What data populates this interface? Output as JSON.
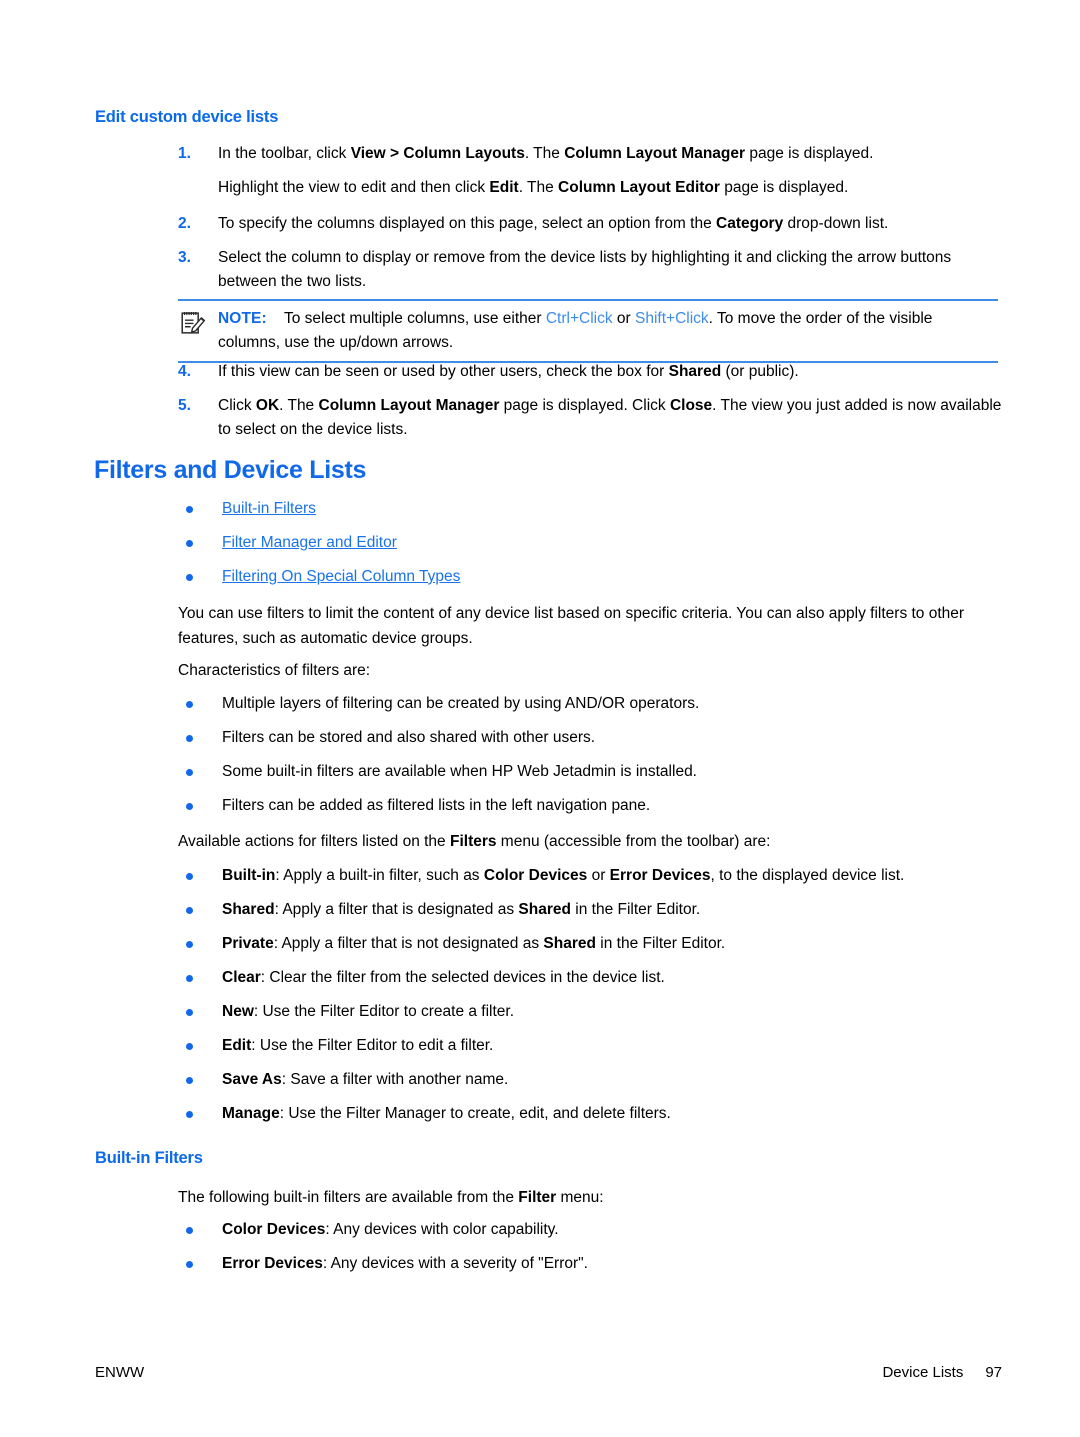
{
  "colors": {
    "heading_blue": "#1168e8",
    "link_blue": "#1a73e8",
    "note_rule": "#3d8ce8",
    "bullet": "#1168e8",
    "text": "#000000"
  },
  "section_edit_custom": {
    "heading": "Edit custom device lists",
    "steps": [
      {
        "num": "1.",
        "parts": [
          {
            "t": "In the toolbar, click ",
            "b": false
          },
          {
            "t": "View > Column Layouts",
            "b": true
          },
          {
            "t": ". The ",
            "b": false
          },
          {
            "t": "Column Layout Manager",
            "b": true
          },
          {
            "t": " page is displayed.",
            "b": false
          }
        ]
      }
    ],
    "step1_continuation": [
      {
        "t": "Highlight the view to edit and then click ",
        "b": false
      },
      {
        "t": "Edit",
        "b": true
      },
      {
        "t": ". The ",
        "b": false
      },
      {
        "t": "Column Layout Editor",
        "b": true
      },
      {
        "t": " page is displayed.",
        "b": false
      }
    ],
    "step2": {
      "num": "2.",
      "parts": [
        {
          "t": "To specify the columns displayed on this page, select an option from the ",
          "b": false
        },
        {
          "t": "Category",
          "b": true
        },
        {
          "t": " drop-down list.",
          "b": false
        }
      ]
    },
    "step3": {
      "num": "3.",
      "parts": [
        {
          "t": "Select the column to display or remove from the device lists by highlighting it and clicking the arrow buttons between the two lists.",
          "b": false
        }
      ]
    },
    "note": {
      "icon": "note-pencil-icon",
      "label": "NOTE:",
      "parts": [
        {
          "t": "To select multiple columns, use either ",
          "b": false,
          "k": false
        },
        {
          "t": "Ctrl+Click",
          "b": false,
          "k": true
        },
        {
          "t": " or ",
          "b": false,
          "k": false
        },
        {
          "t": "Shift+Click",
          "b": false,
          "k": true
        },
        {
          "t": ". To move the order of the visible columns, use the up/down arrows.",
          "b": false,
          "k": false
        }
      ]
    },
    "step4": {
      "num": "4.",
      "parts": [
        {
          "t": "If this view can be seen or used by other users, check the box for ",
          "b": false
        },
        {
          "t": "Shared",
          "b": true
        },
        {
          "t": " (or public).",
          "b": false
        }
      ]
    },
    "step5": {
      "num": "5.",
      "parts": [
        {
          "t": "Click ",
          "b": false
        },
        {
          "t": "OK",
          "b": true
        },
        {
          "t": ". The ",
          "b": false
        },
        {
          "t": "Column Layout Manager",
          "b": true
        },
        {
          "t": " page is displayed. Click ",
          "b": false
        },
        {
          "t": "Close",
          "b": true
        },
        {
          "t": ". The view you just added is now available to select on the device lists.",
          "b": false
        }
      ]
    }
  },
  "section_filters": {
    "heading": "Filters and Device Lists",
    "links": [
      "Built-in Filters",
      "Filter Manager and Editor",
      "Filtering On Special Column Types"
    ],
    "intro_paragraph": "You can use filters to limit the content of any device list based on specific criteria. You can also apply filters to other features, such as automatic device groups.",
    "characteristics_lead": "Characteristics of filters are:",
    "characteristics": [
      "Multiple layers of filtering can be created by using AND/OR operators.",
      "Filters can be stored and also shared with other users.",
      "Some built-in filters are available when HP Web Jetadmin is installed.",
      "Filters can be added as filtered lists in the left navigation pane."
    ],
    "actions_lead": [
      {
        "t": "Available actions for filters listed on the ",
        "b": false
      },
      {
        "t": "Filters",
        "b": true
      },
      {
        "t": " menu (accessible from the toolbar) are:",
        "b": false
      }
    ],
    "actions": [
      [
        {
          "t": "Built-in",
          "b": true
        },
        {
          "t": ": Apply a built-in filter, such as ",
          "b": false
        },
        {
          "t": "Color Devices",
          "b": true
        },
        {
          "t": " or ",
          "b": false
        },
        {
          "t": "Error Devices",
          "b": true
        },
        {
          "t": ", to the displayed device list.",
          "b": false
        }
      ],
      [
        {
          "t": "Shared",
          "b": true
        },
        {
          "t": ": Apply a filter that is designated as ",
          "b": false
        },
        {
          "t": "Shared",
          "b": true
        },
        {
          "t": " in the Filter Editor.",
          "b": false
        }
      ],
      [
        {
          "t": "Private",
          "b": true
        },
        {
          "t": ": Apply a filter that is not designated as ",
          "b": false
        },
        {
          "t": "Shared",
          "b": true
        },
        {
          "t": " in the Filter Editor.",
          "b": false
        }
      ],
      [
        {
          "t": "Clear",
          "b": true
        },
        {
          "t": ": Clear the filter from the selected devices in the device list.",
          "b": false
        }
      ],
      [
        {
          "t": "New",
          "b": true
        },
        {
          "t": ": Use the Filter Editor to create a filter.",
          "b": false
        }
      ],
      [
        {
          "t": "Edit",
          "b": true
        },
        {
          "t": ": Use the Filter Editor to edit a filter.",
          "b": false
        }
      ],
      [
        {
          "t": "Save As",
          "b": true
        },
        {
          "t": ": Save a filter with another name.",
          "b": false
        }
      ],
      [
        {
          "t": "Manage",
          "b": true
        },
        {
          "t": ": Use the Filter Manager to create, edit, and delete filters.",
          "b": false
        }
      ]
    ]
  },
  "section_builtin": {
    "heading": "Built-in Filters",
    "lead": [
      {
        "t": "The following built-in filters are available from the ",
        "b": false
      },
      {
        "t": "Filter",
        "b": true
      },
      {
        "t": " menu:",
        "b": false
      }
    ],
    "items": [
      [
        {
          "t": "Color Devices",
          "b": true
        },
        {
          "t": ": Any devices with color capability.",
          "b": false
        }
      ],
      [
        {
          "t": "Error Devices",
          "b": true
        },
        {
          "t": ": Any devices with a severity of \"Error\".",
          "b": false
        }
      ]
    ]
  },
  "footer": {
    "left": "ENWW",
    "chapter": "Device Lists",
    "page_number": "97"
  }
}
